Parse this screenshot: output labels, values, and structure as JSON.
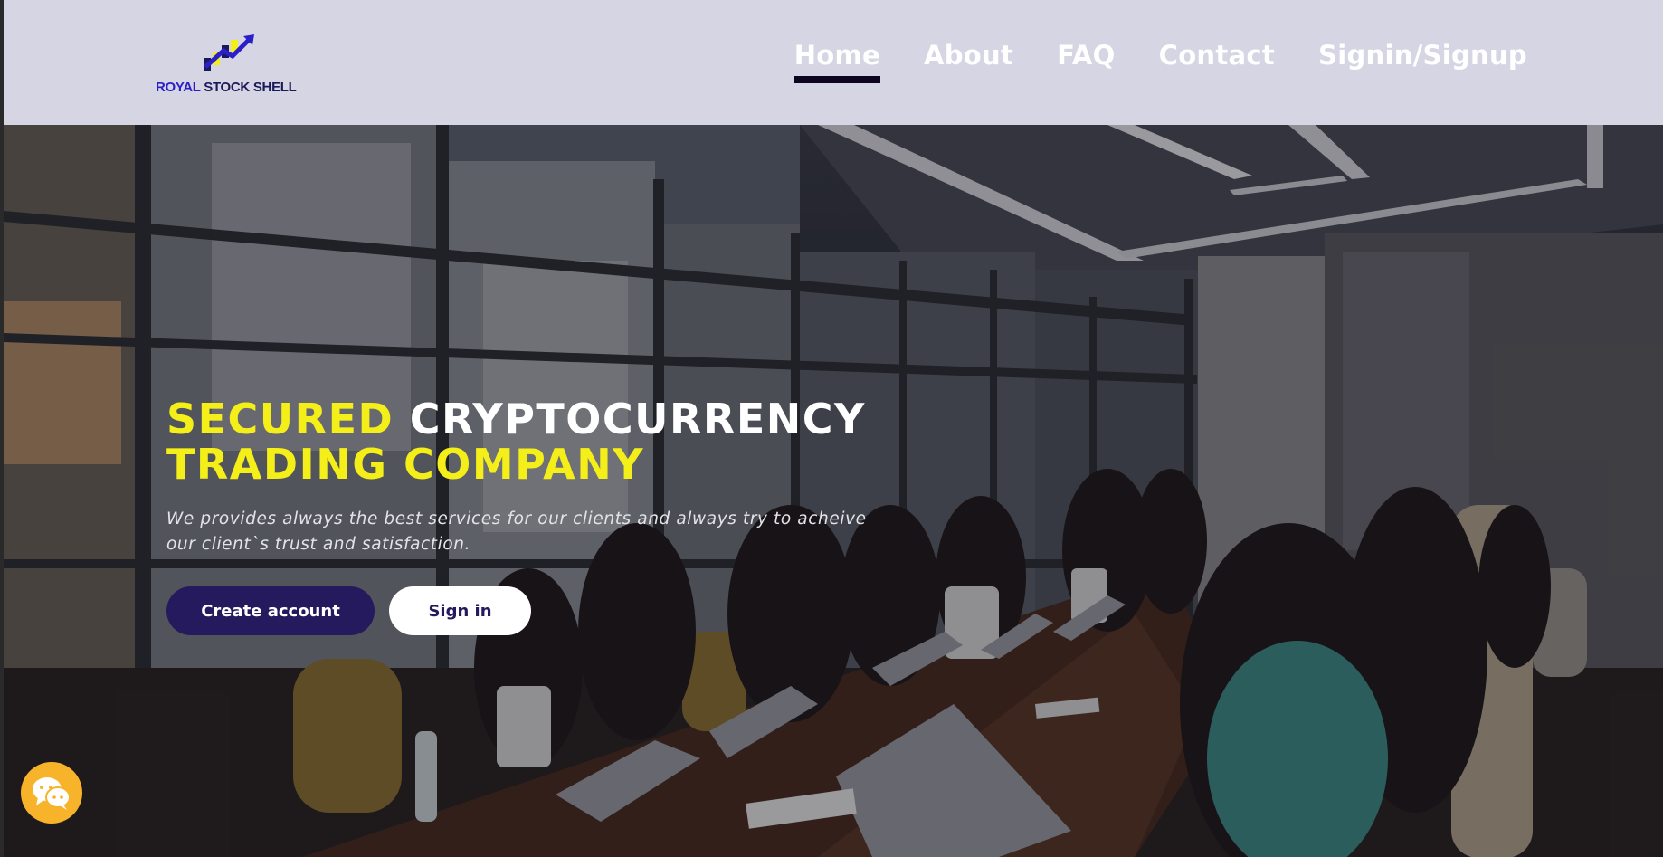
{
  "brand": {
    "name_part1": "ROYAL",
    "name_part2": "STOCK SHELL",
    "logo_icon": "rising-bars-arrow-icon",
    "colors": {
      "primary": "#261a5e",
      "accent_yellow": "#f4ef18",
      "header_bg": "#d6d5e3"
    }
  },
  "nav": {
    "items": [
      {
        "label": "Home",
        "active": true
      },
      {
        "label": "About",
        "active": false
      },
      {
        "label": "FAQ",
        "active": false
      },
      {
        "label": "Contact",
        "active": false
      },
      {
        "label": "Signin/Signup",
        "active": false
      }
    ]
  },
  "hero": {
    "headline_yellow_1": "SECURED",
    "headline_white": "CRYPTOCURRENCY",
    "headline_yellow_2": "TRADING COMPANY",
    "subtext": "We provides always the best services for our clients and always try to acheive our client`s trust and satisfaction.",
    "primary_button": "Create account",
    "secondary_button": "Sign in",
    "background_image": "office-meeting-photo"
  },
  "chat": {
    "icon": "chat-bubbles-icon"
  }
}
